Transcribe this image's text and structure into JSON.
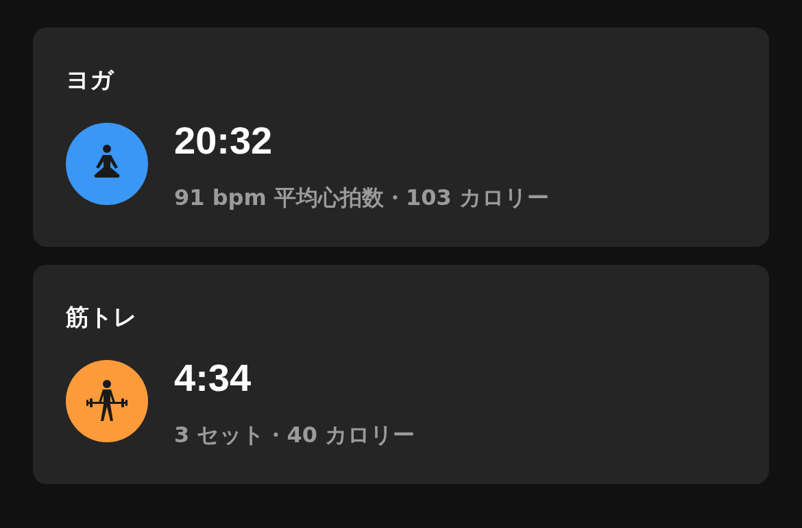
{
  "workouts": [
    {
      "title": "ヨガ",
      "kind": "yoga",
      "color": "#3a97f5",
      "duration": "20:32",
      "details": "91 bpm 平均心拍数・103 カロリー"
    },
    {
      "title": "筋トレ",
      "kind": "strength",
      "color": "#fd9b3a",
      "duration": "4:34",
      "details": "3 セット・40 カロリー"
    }
  ]
}
